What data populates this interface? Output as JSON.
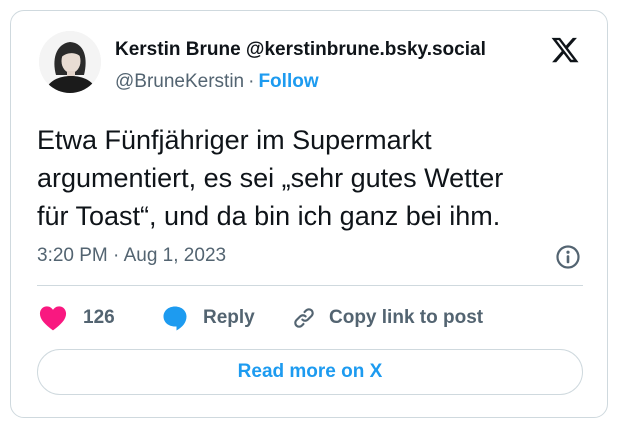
{
  "author": {
    "display_name": "Kerstin Brune @kerstinbrune.bsky.social",
    "handle": "@BruneKerstin",
    "separator": "·",
    "follow_label": "Follow"
  },
  "tweet": {
    "text": "Etwa Fünfjähriger im Supermarkt\nargumentiert, es sei „sehr gutes Wetter\nfür Toast“, und da bin ich ganz bei ihm.",
    "timestamp": "3:20 PM · Aug 1, 2023"
  },
  "actions": {
    "like_count": "126",
    "reply_label": "Reply",
    "copy_label": "Copy link to post"
  },
  "footer": {
    "read_more_label": "Read more on X"
  },
  "icons": {
    "brand": "x-logo-icon",
    "info": "info-icon",
    "like": "heart-icon",
    "reply": "speech-bubble-icon",
    "copy": "link-icon"
  },
  "colors": {
    "accent": "#1d9bf0",
    "like": "#f91880",
    "text": "#0f1419",
    "muted": "#536471",
    "border": "#cfd9de"
  }
}
